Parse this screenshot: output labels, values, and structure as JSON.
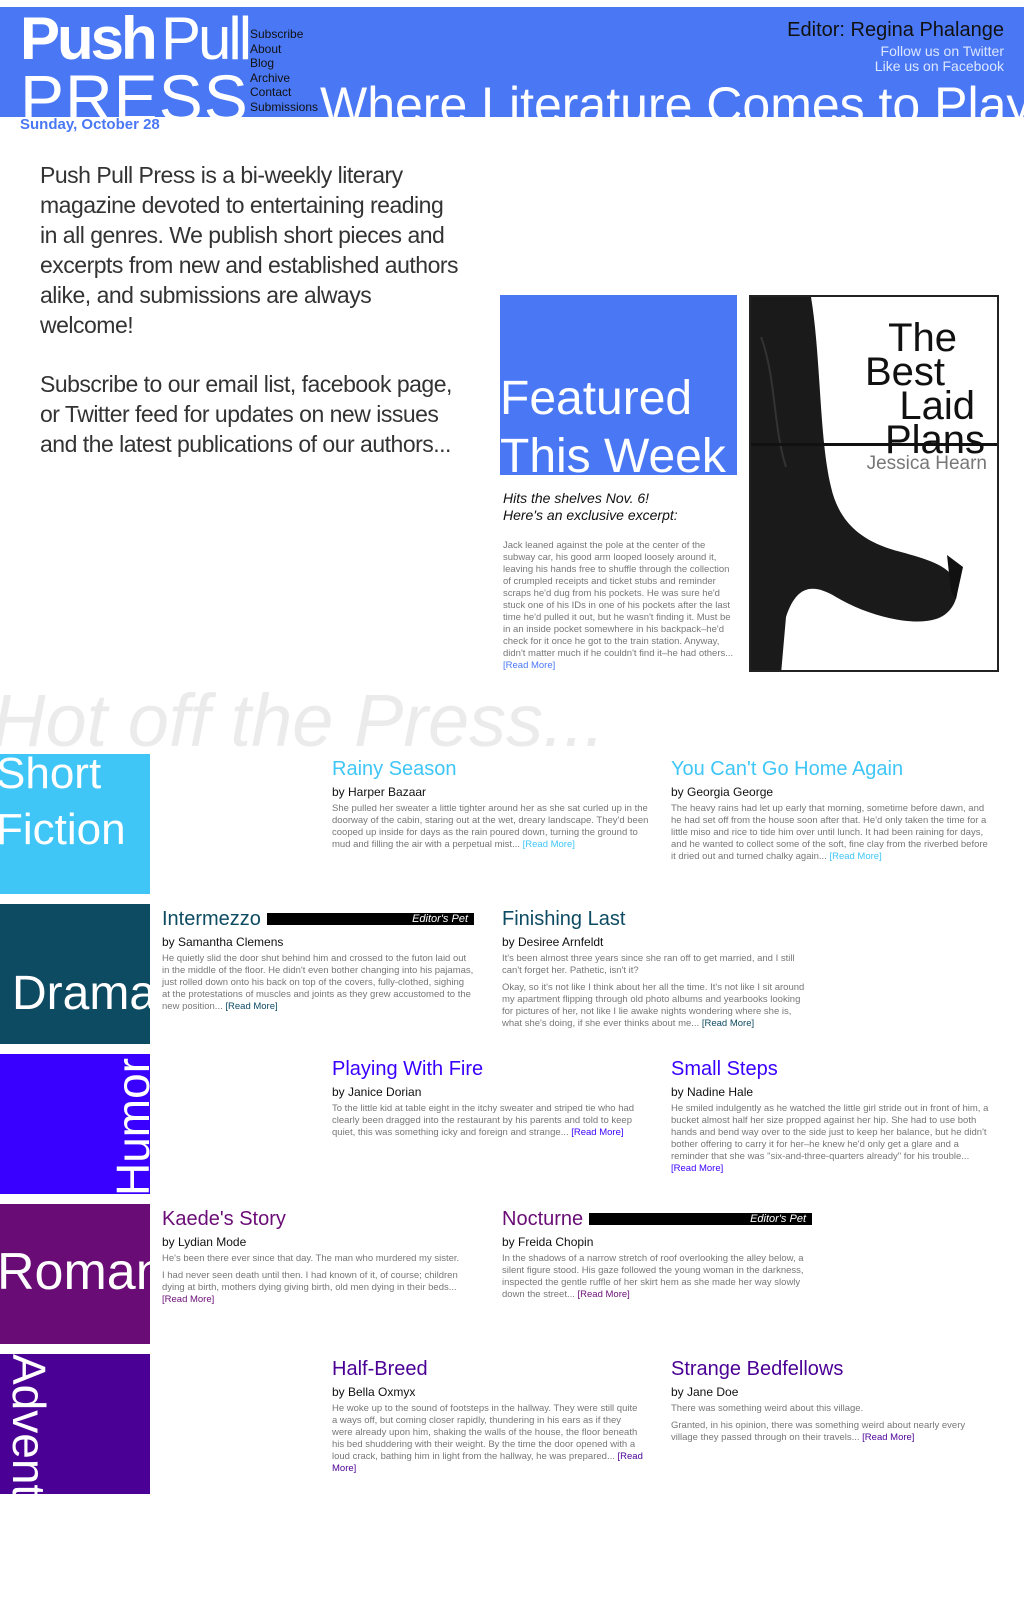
{
  "header": {
    "logo_push": "Push",
    "logo_pull": "Pull",
    "logo_press": "PRESS",
    "nav": [
      "Subscribe",
      "About",
      "Blog",
      "Archive",
      "Contact",
      "Submissions"
    ],
    "editor": "Editor: Regina Phalange",
    "twitter": "Follow us on Twitter",
    "facebook": "Like us on Facebook",
    "tagline": "Where Literature Comes to Play...",
    "date": "Sunday, October 28"
  },
  "intro": {
    "p1": "Push Pull Press is a bi-weekly literary magazine devoted to entertaining reading in all genres. We publish short pieces and excerpts from new and established authors alike, and submissions are always welcome!",
    "p2": "Subscribe to our email list, facebook page, or Twitter feed for updates on new issues and the latest publications of our authors..."
  },
  "featured": {
    "title_line1": "Featured",
    "title_line2": "This Week",
    "sub1": "Hits the shelves Nov. 6!",
    "sub2": "Here's an exclusive excerpt:",
    "excerpt": "Jack leaned against the pole at the center of the subway car, his good arm looped loosely around it, leaving his hands free to shuffle through the collection of crumpled receipts and ticket stubs and reminder scraps he'd dug from his pockets. He was sure he'd stuck one of his IDs in one of his pockets after the last time he'd pulled it out, but he wasn't finding it. Must be in an inside pocket somewhere in his backpack–he'd check for it once he got to the train station. Anyway, didn't matter much if he couldn't find it–he had others...",
    "read_more": "[Read More]",
    "book_title": [
      "The",
      "Best",
      "Laid",
      "Plans"
    ],
    "book_author": "Jessica Hearn"
  },
  "hot_title": "Hot off the Press...",
  "editors_pet": "Editor's Pet",
  "categories": [
    {
      "label": "Short Fiction",
      "line1": "Short",
      "line2": "Fiction",
      "color": "#3fc6f7",
      "title_color": "#3fc6f7"
    },
    {
      "label": "Drama",
      "color": "#0d4b63",
      "title_color": "#0d4b63"
    },
    {
      "label": "Humor",
      "color": "#3a00ff",
      "title_color": "#3a00ff"
    },
    {
      "label": "Romance",
      "display": "Roman",
      "color": "#6a0c76",
      "title_color": "#6a0c76"
    },
    {
      "label": "Adventure",
      "display": "Advent",
      "color": "#4a0095",
      "title_color": "#4a0095"
    }
  ],
  "stories": {
    "rainy": {
      "title": "Rainy Season",
      "author": "by Harper Bazaar",
      "body": [
        "She pulled her sweater a little tighter around her as she sat curled up in the doorway of the cabin, staring out at the wet, dreary landscape. They'd been cooped up inside for days as the rain poured down, turning the ground to mud and filling the air with a perpetual mist..."
      ],
      "read_more": "[Read More]"
    },
    "home": {
      "title": "You Can't Go Home Again",
      "author": "by Georgia George",
      "body": [
        "The heavy rains had let up early that morning, sometime before dawn, and he had set off from the house soon after that. He'd only taken the time for a little miso and rice to tide him over until lunch. It had been raining for days, and he wanted to collect some of the soft, fine clay from the riverbed before it dried out and turned chalky again..."
      ],
      "read_more": "[Read More]"
    },
    "intermezzo": {
      "title": "Intermezzo",
      "author": "by Samantha Clemens",
      "body": [
        "He quietly slid the door shut behind him and crossed to the futon laid out in the middle of the floor. He didn't even bother changing into his pajamas, just rolled down onto his back on top of the covers, fully-clothed, sighing at the protestations of muscles and joints as they grew accustomed to the new position..."
      ],
      "read_more": "[Read More]"
    },
    "finishing": {
      "title": "Finishing Last",
      "author": "by Desiree Arnfeldt",
      "body": [
        "It's been almost three years since she ran off to get married, and I still can't forget her. Pathetic, isn't it?",
        "Okay, so it's not like I think about her all the time. It's not like I sit around my apartment flipping through old photo albums and yearbooks looking for pictures of her, not like I lie awake nights wondering where she is, what she's doing, if she ever thinks about me..."
      ],
      "read_more": "[Read More]"
    },
    "fire": {
      "title": "Playing With Fire",
      "author": "by Janice Dorian",
      "body": [
        "To the little kid at table eight in the itchy sweater and striped tie who had clearly been dragged into the restaurant by his parents and told to keep quiet, this was something icky and foreign and strange..."
      ],
      "read_more": "[Read More]"
    },
    "steps": {
      "title": "Small Steps",
      "author": "by Nadine Hale",
      "body": [
        "He smiled indulgently as he watched the little girl stride out in front of him, a bucket almost half her size propped against her hip. She had to use both hands and bend way over to the side just to keep her balance, but he didn't bother offering to carry it for her–he knew he'd only get a glare and a reminder that she was \"six-and-three-quarters already\" for his trouble..."
      ],
      "read_more": "[Read More]"
    },
    "kaede": {
      "title": "Kaede's Story",
      "author": "by Lydian Mode",
      "body": [
        "He's been there ever since that day. The man who murdered my sister.",
        "I had never seen death until then. I had known of it, of course; children dying at birth, mothers dying giving birth, old men dying in their beds..."
      ],
      "read_more": "[Read More]"
    },
    "nocturne": {
      "title": "Nocturne",
      "author": "by Freida Chopin",
      "body": [
        "In the shadows of a narrow stretch of roof overlooking the alley below, a silent figure stood. His gaze followed the young woman in the darkness, inspected the gentle ruffle of her skirt hem as she made her way slowly down the street..."
      ],
      "read_more": "[Read More]"
    },
    "halfbreed": {
      "title": "Half-Breed",
      "author": "by Bella Oxmyx",
      "body": [
        "He woke up to the sound of footsteps in the hallway. They were still quite a ways off, but coming closer rapidly, thundering in his ears as if they were already upon him, shaking the walls of the house, the floor beneath his bed shuddering with their weight. By the time the door opened with a loud crack, bathing him in light from the hallway, he was prepared..."
      ],
      "read_more": "[Read More]"
    },
    "bedfellows": {
      "title": "Strange Bedfellows",
      "author": "by Jane Doe",
      "body": [
        "There was something weird about this village.",
        "Granted, in his opinion, there was something weird about nearly every village they passed through on their travels..."
      ],
      "read_more": "[Read More]"
    }
  }
}
